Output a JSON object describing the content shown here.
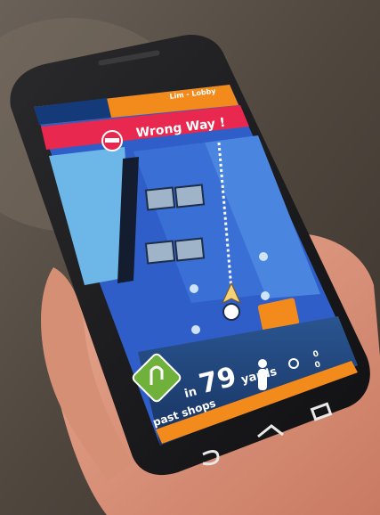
{
  "screen": {
    "alert": "Wrong Way !",
    "distance_prefix": "in",
    "distance_value": "79",
    "distance_unit": "yards",
    "street": "past shops",
    "speed_top": "0",
    "speed_bottom": "0",
    "header_brand": "Lim - Lobby"
  },
  "colors": {
    "alert_red": "#e8284e",
    "header_orange": "#f28a1c",
    "map_blue": "#2f5ec8",
    "map_light": "#6db6e8",
    "sign_green": "#6fb13a",
    "bottom_bar": "#1e3f73"
  },
  "icons": {
    "no_entry": "no-entry-icon",
    "turn": "u-turn-icon",
    "walker": "person-icon",
    "arrow": "navigation-arrow-icon"
  }
}
